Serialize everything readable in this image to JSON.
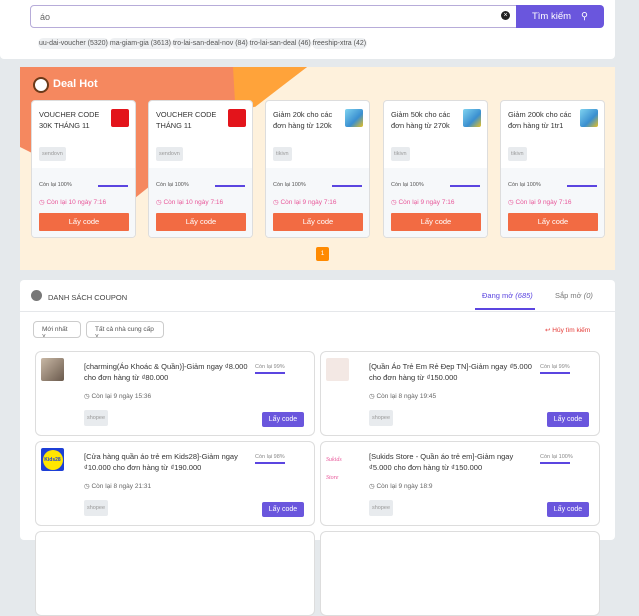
{
  "search": {
    "value": "áo",
    "button_label": "Tìm kiếm",
    "tags": [
      "uu-dai-voucher (5320)",
      "ma-giam-gia (3613)",
      "tro-lai-san-deal-nov (84)",
      "tro-lai-san-deal (46)",
      "freeship-xtra (42)"
    ]
  },
  "deal_hot": {
    "title": "Deal Hot",
    "page": "1",
    "cards": [
      {
        "title": "VOUCHER CODE 30K THÁNG 11",
        "tag": "sendovn",
        "remaining": "Còn lại 100%",
        "remaining_pct": 100,
        "time": "Còn lại 10 ngày 7:16",
        "button": "Lấy code"
      },
      {
        "title": "VOUCHER CODE THÁNG 11",
        "tag": "sendovn",
        "remaining": "Còn lại 100%",
        "remaining_pct": 100,
        "time": "Còn lại 10 ngày 7:16",
        "button": "Lấy code"
      },
      {
        "title": "Giảm 20k cho các đơn hàng từ 120k",
        "tag": "tikivn",
        "remaining": "Còn lại 100%",
        "remaining_pct": 100,
        "time": "Còn lại 9 ngày 7:16",
        "button": "Lấy code"
      },
      {
        "title": "Giảm 50k cho các đơn hàng từ 270k",
        "tag": "tikivn",
        "remaining": "Còn lại 100%",
        "remaining_pct": 100,
        "time": "Còn lại 9 ngày 7:16",
        "button": "Lấy code"
      },
      {
        "title": "Giảm 200k cho các đơn hàng từ 1tr1",
        "tag": "tikivn",
        "remaining": "Còn lại 100%",
        "remaining_pct": 100,
        "time": "Còn lại 9 ngày 7:16",
        "button": "Lấy code"
      }
    ]
  },
  "coupons": {
    "title": "DANH SÁCH COUPON",
    "tabs": [
      {
        "label": "Đang mở",
        "count": "(685)"
      },
      {
        "label": "Sắp mở",
        "count": "(0)"
      }
    ],
    "sort": "Mới nhất",
    "provider": "Tất cả nhà cung cấp",
    "cancel": "Hủy tìm kiếm",
    "items": [
      {
        "title": "[charming(Áo Khoác & Quần)]-Giảm ngay ₫8.000 cho đơn hàng từ ₫80.000",
        "remaining": "Còn lại 99%",
        "time": "Còn lại 9 ngày 15:36",
        "tag": "shopee",
        "button": "Lấy code"
      },
      {
        "title": "[Quần Áo Trẻ Em Rẻ Đẹp TN]-Giảm ngay ₫5.000 cho đơn hàng từ ₫150.000",
        "remaining": "Còn lại 99%",
        "time": "Còn lại 8 ngày 19:45",
        "tag": "shopee",
        "button": "Lấy code"
      },
      {
        "title": "[Cửa hàng quần áo trẻ em Kids28]-Giảm ngay ₫10.000 cho đơn hàng từ ₫190.000",
        "remaining": "Còn lại 98%",
        "time": "Còn lại 8 ngày 21:31",
        "tag": "shopee",
        "button": "Lấy code",
        "logo_text": "Kids28"
      },
      {
        "title": "[Sukids Store - Quần áo trẻ em]-Giảm ngay ₫5.000 cho đơn hàng từ ₫150.000",
        "remaining": "Còn lại 100%",
        "time": "Còn lại 9 ngày 18:9",
        "tag": "shopee",
        "button": "Lấy code",
        "logo_text": "Sukids Store"
      }
    ]
  },
  "colors": {
    "primary": "#6a56dd",
    "deal_button": "#f26b43",
    "deal_bg": "#fef1dc",
    "time_pink": "#e8589a",
    "cancel_red": "#e53935"
  }
}
